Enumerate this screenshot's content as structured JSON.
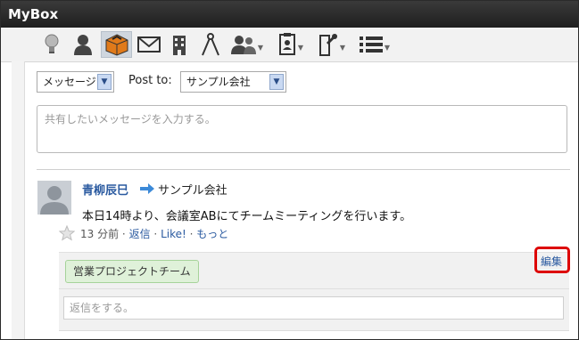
{
  "app": {
    "title": "MyBox"
  },
  "toolbar": {
    "icons": [
      "lightbulb-icon",
      "user-icon",
      "box-icon",
      "mail-icon",
      "building-icon",
      "compass-icon",
      "group-icon",
      "contact-card-icon",
      "pin-icon",
      "list-icon"
    ]
  },
  "compose": {
    "type_select": "メッセージ",
    "post_to_label": "Post to:",
    "post_to_select": "サンプル会社",
    "placeholder": "共有したいメッセージを入力する。"
  },
  "post": {
    "author": "青柳辰巳",
    "target": "サンプル会社",
    "message": "本日14時より、会議室ABにてチームミーティングを行います。",
    "time": "13 分前",
    "sep": "·",
    "reply_link": "返信",
    "like_link": "Like!",
    "more_link": "もっと",
    "tag": "営業プロジェクトチーム",
    "edit_link": "編集",
    "reply_placeholder": "返信をする。"
  },
  "colors": {
    "link": "#2a5aa0",
    "highlight": "#dd0000",
    "tag_bg": "#dff1d9"
  }
}
